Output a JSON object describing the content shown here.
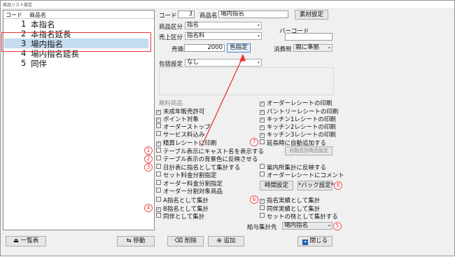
{
  "window": {
    "title": "商品リスト設定"
  },
  "list": {
    "header_code": "コード",
    "header_name": "商品名",
    "items": [
      {
        "code": "1",
        "name": "本指名"
      },
      {
        "code": "2",
        "name": "本指名延長"
      },
      {
        "code": "3",
        "name": "場内指名"
      },
      {
        "code": "4",
        "name": "場内指名延長"
      },
      {
        "code": "5",
        "name": "同伴"
      }
    ]
  },
  "form": {
    "code_label": "コード",
    "code_value": "3",
    "name_label": "商品名",
    "name_value": "場内指名",
    "material_button": "素材設定",
    "category_label": "商品区分",
    "category_value": "指名",
    "sales_label": "売上区分",
    "sales_value": "指名料",
    "barcode_label": "バーコード",
    "price_label": "売価",
    "price_value": "2000",
    "color_button": "色指定",
    "tax_label": "消費税",
    "tax_value": "親に準拠",
    "package_label": "包括設定",
    "package_value": "なし"
  },
  "left_options": {
    "free_item": "無料商品",
    "items": [
      {
        "label": "未成年販売許可",
        "checked": true
      },
      {
        "label": "ポイント対象",
        "checked": true
      },
      {
        "label": "オーダーストップ",
        "checked": false
      },
      {
        "label": "サービス料込み",
        "checked": false
      },
      {
        "label": "精算レシートに印刷",
        "checked": true
      },
      {
        "label": "テーブル表示にキャスト名を表示する",
        "checked": false
      },
      {
        "label": "テーブル表示の背景色に反映させる",
        "checked": false
      },
      {
        "label": "日計表に指名として集計する",
        "checked": false
      },
      {
        "label": "セット料金分割指定",
        "checked": false
      },
      {
        "label": "オーダー料金分割指定",
        "checked": false
      },
      {
        "label": "オーダー分割対象商品",
        "checked": false
      },
      {
        "label": "A指名として集計",
        "checked": false
      },
      {
        "label": "B指名として集計",
        "checked": true
      },
      {
        "label": "同伴として集計",
        "checked": false
      }
    ]
  },
  "right_options": {
    "items": [
      {
        "label": "オーダーレシートの印刷",
        "checked": true
      },
      {
        "label": "パントリーレシートの印刷",
        "checked": true
      },
      {
        "label": "キッチン1レシートの印刷",
        "checked": true
      },
      {
        "label": "キッチン2レシートの印刷",
        "checked": true
      },
      {
        "label": "キッチン3レシートの印刷",
        "checked": true
      },
      {
        "label": "延長時に自動追加する",
        "checked": false
      }
    ],
    "auto_add_button": "自動追加商品設定",
    "guide_reflect": "案内所集計に反映する",
    "order_comment": "オーダーレシートにコメント",
    "time_button": "時間設定",
    "back_button": "*バック設定*",
    "aggregate_items": [
      {
        "label": "指名実績として集計",
        "checked": true
      },
      {
        "label": "同伴実績として集計",
        "checked": false
      },
      {
        "label": "セットの枝として集計する",
        "checked": false
      }
    ],
    "salary_label": "給与集計先",
    "salary_value": "場内指名"
  },
  "annotations": [
    "1",
    "2",
    "3",
    "4",
    "5",
    "6",
    "7",
    "8"
  ],
  "footer": {
    "list_button": "一覧表",
    "move_button": "移動",
    "delete_button": "削除",
    "add_button": "追加",
    "close_button": "閉じる"
  },
  "colors": {
    "selection": "#c5dcef",
    "annotation": "#e33333",
    "close_icon": "#1a5fb4"
  }
}
